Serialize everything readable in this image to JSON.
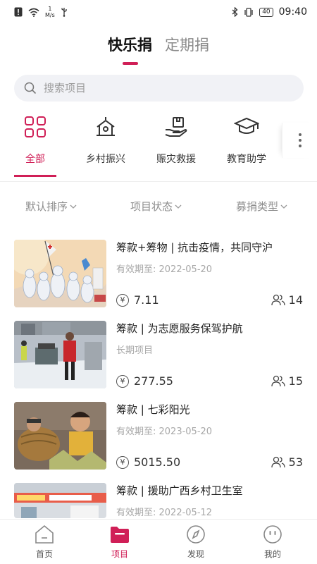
{
  "status_bar": {
    "net_speed_value": "1",
    "net_speed_unit": "M/s",
    "battery": "40",
    "time": "09:40"
  },
  "top_tabs": [
    {
      "label": "快乐捐",
      "active": true
    },
    {
      "label": "定期捐",
      "active": false
    }
  ],
  "search": {
    "placeholder": "搜索项目",
    "value": ""
  },
  "categories": [
    {
      "label": "全部",
      "icon": "grid-icon",
      "active": true
    },
    {
      "label": "乡村振兴",
      "icon": "village-house-icon",
      "active": false
    },
    {
      "label": "赈灾救援",
      "icon": "hand-box-icon",
      "active": false
    },
    {
      "label": "教育助学",
      "icon": "graduation-cap-icon",
      "active": false
    }
  ],
  "filters": [
    {
      "label": "默认排序"
    },
    {
      "label": "项目状态"
    },
    {
      "label": "募捐类型"
    }
  ],
  "projects": [
    {
      "title": "筹款+筹物 | 抗击疫情，共同守沪",
      "subtitle": "有效期至: 2022-05-20",
      "amount": "7.11",
      "donors": "14"
    },
    {
      "title": "筹款 | 为志愿服务保驾护航",
      "subtitle": "长期项目",
      "amount": "277.55",
      "donors": "15"
    },
    {
      "title": "筹款 | 七彩阳光",
      "subtitle": "有效期至: 2023-05-20",
      "amount": "5015.50",
      "donors": "53"
    },
    {
      "title": "筹款 | 援助广西乡村卫生室",
      "subtitle": "有效期至: 2022-05-12",
      "amount": "",
      "donors": ""
    }
  ],
  "currency_symbol": "¥",
  "bottom_nav": [
    {
      "label": "首页",
      "icon": "home-icon",
      "active": false
    },
    {
      "label": "项目",
      "icon": "folder-icon",
      "active": true
    },
    {
      "label": "发现",
      "icon": "compass-icon",
      "active": false
    },
    {
      "label": "我的",
      "icon": "profile-face-icon",
      "active": false
    }
  ],
  "colors": {
    "accent": "#d01f57",
    "search_bg": "#f1f2f6",
    "muted_text": "#8d8d8d"
  }
}
